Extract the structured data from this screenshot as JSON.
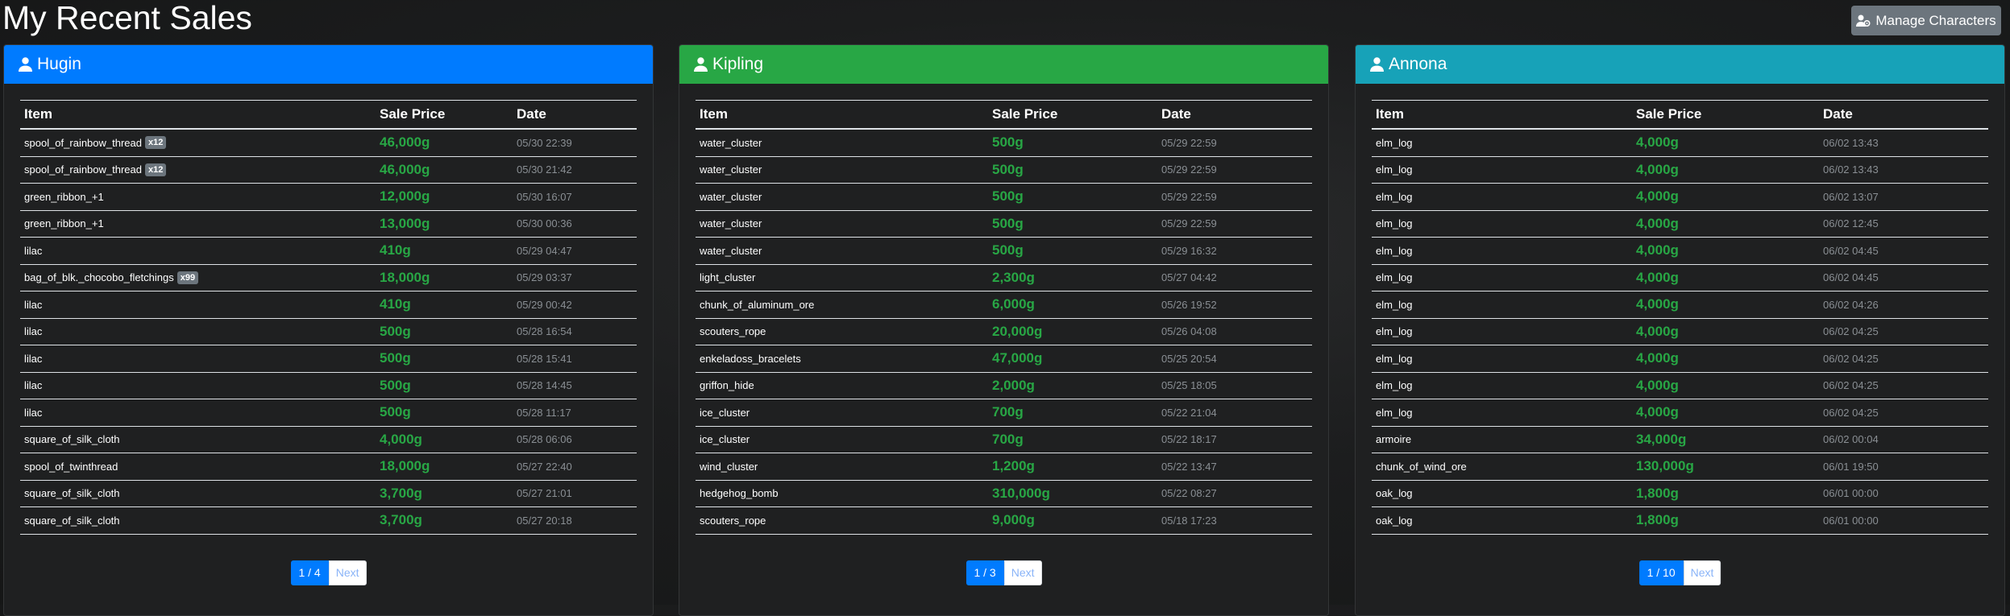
{
  "page": {
    "title": "My Recent Sales"
  },
  "toolbar": {
    "manage_label": "Manage Characters"
  },
  "table_headers": {
    "item": "Item",
    "price": "Sale Price",
    "date": "Date"
  },
  "pagination": {
    "next_label": "Next"
  },
  "characters": [
    {
      "name": "Hugin",
      "page": "1 / 4",
      "sales": [
        {
          "item": "spool_of_rainbow_thread",
          "qty": "x12",
          "price": "46,000g",
          "date": "05/30 22:39"
        },
        {
          "item": "spool_of_rainbow_thread",
          "qty": "x12",
          "price": "46,000g",
          "date": "05/30 21:42"
        },
        {
          "item": "green_ribbon_+1",
          "qty": "",
          "price": "12,000g",
          "date": "05/30 16:07"
        },
        {
          "item": "green_ribbon_+1",
          "qty": "",
          "price": "13,000g",
          "date": "05/30 00:36"
        },
        {
          "item": "lilac",
          "qty": "",
          "price": "410g",
          "date": "05/29 04:47"
        },
        {
          "item": "bag_of_blk._chocobo_fletchings",
          "qty": "x99",
          "price": "18,000g",
          "date": "05/29 03:37"
        },
        {
          "item": "lilac",
          "qty": "",
          "price": "410g",
          "date": "05/29 00:42"
        },
        {
          "item": "lilac",
          "qty": "",
          "price": "500g",
          "date": "05/28 16:54"
        },
        {
          "item": "lilac",
          "qty": "",
          "price": "500g",
          "date": "05/28 15:41"
        },
        {
          "item": "lilac",
          "qty": "",
          "price": "500g",
          "date": "05/28 14:45"
        },
        {
          "item": "lilac",
          "qty": "",
          "price": "500g",
          "date": "05/28 11:17"
        },
        {
          "item": "square_of_silk_cloth",
          "qty": "",
          "price": "4,000g",
          "date": "05/28 06:06"
        },
        {
          "item": "spool_of_twinthread",
          "qty": "",
          "price": "18,000g",
          "date": "05/27 22:40"
        },
        {
          "item": "square_of_silk_cloth",
          "qty": "",
          "price": "3,700g",
          "date": "05/27 21:01"
        },
        {
          "item": "square_of_silk_cloth",
          "qty": "",
          "price": "3,700g",
          "date": "05/27 20:18"
        }
      ]
    },
    {
      "name": "Kipling",
      "page": "1 / 3",
      "sales": [
        {
          "item": "water_cluster",
          "qty": "",
          "price": "500g",
          "date": "05/29 22:59"
        },
        {
          "item": "water_cluster",
          "qty": "",
          "price": "500g",
          "date": "05/29 22:59"
        },
        {
          "item": "water_cluster",
          "qty": "",
          "price": "500g",
          "date": "05/29 22:59"
        },
        {
          "item": "water_cluster",
          "qty": "",
          "price": "500g",
          "date": "05/29 22:59"
        },
        {
          "item": "water_cluster",
          "qty": "",
          "price": "500g",
          "date": "05/29 16:32"
        },
        {
          "item": "light_cluster",
          "qty": "",
          "price": "2,300g",
          "date": "05/27 04:42"
        },
        {
          "item": "chunk_of_aluminum_ore",
          "qty": "",
          "price": "6,000g",
          "date": "05/26 19:52"
        },
        {
          "item": "scouters_rope",
          "qty": "",
          "price": "20,000g",
          "date": "05/26 04:08"
        },
        {
          "item": "enkeladoss_bracelets",
          "qty": "",
          "price": "47,000g",
          "date": "05/25 20:54"
        },
        {
          "item": "griffon_hide",
          "qty": "",
          "price": "2,000g",
          "date": "05/25 18:05"
        },
        {
          "item": "ice_cluster",
          "qty": "",
          "price": "700g",
          "date": "05/22 21:04"
        },
        {
          "item": "ice_cluster",
          "qty": "",
          "price": "700g",
          "date": "05/22 18:17"
        },
        {
          "item": "wind_cluster",
          "qty": "",
          "price": "1,200g",
          "date": "05/22 13:47"
        },
        {
          "item": "hedgehog_bomb",
          "qty": "",
          "price": "310,000g",
          "date": "05/22 08:27"
        },
        {
          "item": "scouters_rope",
          "qty": "",
          "price": "9,000g",
          "date": "05/18 17:23"
        }
      ]
    },
    {
      "name": "Annona",
      "page": "1 / 10",
      "sales": [
        {
          "item": "elm_log",
          "qty": "",
          "price": "4,000g",
          "date": "06/02 13:43"
        },
        {
          "item": "elm_log",
          "qty": "",
          "price": "4,000g",
          "date": "06/02 13:43"
        },
        {
          "item": "elm_log",
          "qty": "",
          "price": "4,000g",
          "date": "06/02 13:07"
        },
        {
          "item": "elm_log",
          "qty": "",
          "price": "4,000g",
          "date": "06/02 12:45"
        },
        {
          "item": "elm_log",
          "qty": "",
          "price": "4,000g",
          "date": "06/02 04:45"
        },
        {
          "item": "elm_log",
          "qty": "",
          "price": "4,000g",
          "date": "06/02 04:45"
        },
        {
          "item": "elm_log",
          "qty": "",
          "price": "4,000g",
          "date": "06/02 04:26"
        },
        {
          "item": "elm_log",
          "qty": "",
          "price": "4,000g",
          "date": "06/02 04:25"
        },
        {
          "item": "elm_log",
          "qty": "",
          "price": "4,000g",
          "date": "06/02 04:25"
        },
        {
          "item": "elm_log",
          "qty": "",
          "price": "4,000g",
          "date": "06/02 04:25"
        },
        {
          "item": "elm_log",
          "qty": "",
          "price": "4,000g",
          "date": "06/02 04:25"
        },
        {
          "item": "armoire",
          "qty": "",
          "price": "34,000g",
          "date": "06/02 00:04"
        },
        {
          "item": "chunk_of_wind_ore",
          "qty": "",
          "price": "130,000g",
          "date": "06/01 19:50"
        },
        {
          "item": "oak_log",
          "qty": "",
          "price": "1,800g",
          "date": "06/01 00:00"
        },
        {
          "item": "oak_log",
          "qty": "",
          "price": "1,800g",
          "date": "06/01 00:00"
        }
      ]
    }
  ]
}
